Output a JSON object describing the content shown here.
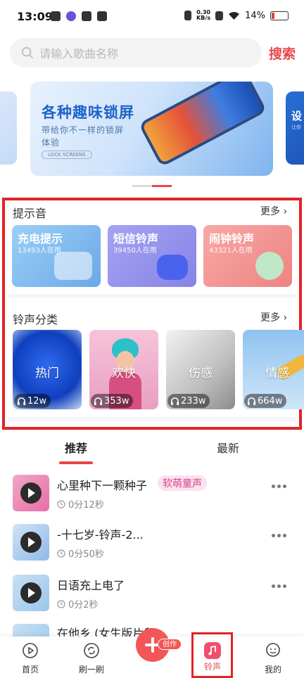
{
  "status_bar": {
    "time": "13:09",
    "speed_value": "0.30",
    "speed_unit": "KB/s",
    "battery": "14%"
  },
  "search": {
    "placeholder": "请输入歌曲名称",
    "button": "搜索"
  },
  "banner": {
    "title": "各种趣味锁屏",
    "subtitle": "带给你不一样的锁屏体验",
    "badge": "LOCK SCREENS",
    "next_title": "设",
    "next_subtitle": "让你"
  },
  "alerts": {
    "title": "提示音",
    "more": "更多",
    "items": [
      {
        "name": "充电提示",
        "count": "13493人在用"
      },
      {
        "name": "短信铃声",
        "count": "39450人在用"
      },
      {
        "name": "闹钟铃声",
        "count": "43321人在用"
      }
    ]
  },
  "categories": {
    "title": "铃声分类",
    "more": "更多",
    "items": [
      {
        "name": "热门",
        "plays": "12w"
      },
      {
        "name": "欢快",
        "plays": "353w"
      },
      {
        "name": "伤感",
        "plays": "233w"
      },
      {
        "name": "情感",
        "plays": "664w"
      }
    ]
  },
  "tabs": [
    {
      "label": "推荐"
    },
    {
      "label": "最新"
    }
  ],
  "songs": [
    {
      "title": "心里种下一颗种子",
      "tag": "软萌童声",
      "duration": "0分12秒"
    },
    {
      "title": "-十七岁-铃声-2...",
      "duration": "0分50秒"
    },
    {
      "title": "日语充上电了",
      "duration": "0分2秒"
    },
    {
      "title": "在他乡 (女生版片段)"
    }
  ],
  "bottom_nav": {
    "items": [
      {
        "label": "首页"
      },
      {
        "label": "刷一刷"
      },
      {
        "label": "铃声"
      },
      {
        "label": "我的"
      }
    ],
    "create_badge": "创作"
  },
  "colors": {
    "accent": "#e8474a",
    "highlight_box": "#e02427",
    "tag_text": "#d6448b"
  }
}
